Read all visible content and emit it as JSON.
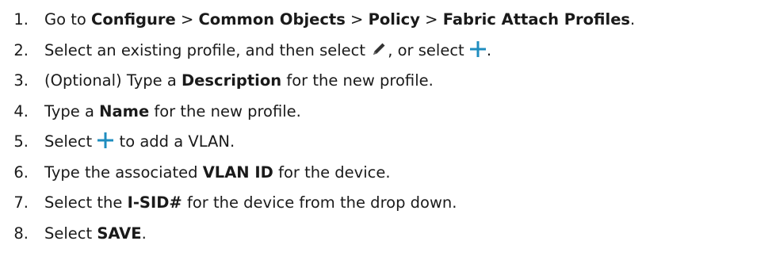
{
  "steps": [
    {
      "number": "1.",
      "parts": {
        "t1": "Go to ",
        "b1": "Configure",
        "t2": " > ",
        "b2": "Common Objects",
        "t3": " > ",
        "b3": "Policy",
        "t4": " > ",
        "b4": "Fabric Attach Profiles",
        "t5": "."
      }
    },
    {
      "number": "2.",
      "parts": {
        "t1": "Select an existing profile, and then select ",
        "t2": ", or select ",
        "t3": "."
      }
    },
    {
      "number": "3.",
      "parts": {
        "t1": "(Optional) Type a ",
        "b1": "Description",
        "t2": " for the new profile."
      }
    },
    {
      "number": "4.",
      "parts": {
        "t1": "Type a ",
        "b1": "Name",
        "t2": " for the new profile."
      }
    },
    {
      "number": "5.",
      "parts": {
        "t1": "Select ",
        "t2": " to add a VLAN."
      }
    },
    {
      "number": "6.",
      "parts": {
        "t1": "Type the associated ",
        "b1": "VLAN ID",
        "t2": " for the device."
      }
    },
    {
      "number": "7.",
      "parts": {
        "t1": "Select the ",
        "b1": "I-SID#",
        "t2": " for the device from the drop down."
      }
    },
    {
      "number": "8.",
      "parts": {
        "t1": "Select ",
        "b1": "SAVE",
        "t2": "."
      }
    }
  ],
  "icons": {
    "edit": "pencil-icon",
    "add": "plus-icon",
    "add_color": "#1f8dbf",
    "edit_color": "#333333"
  }
}
